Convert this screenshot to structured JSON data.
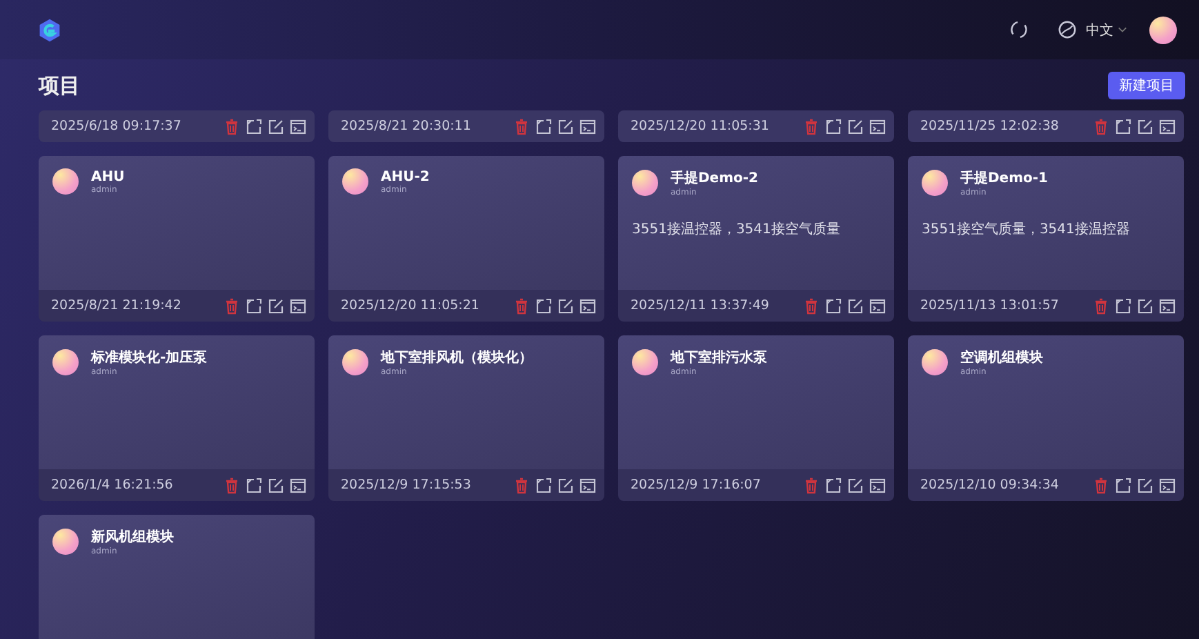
{
  "header": {
    "language": "中文"
  },
  "page": {
    "title": "项目",
    "new_button": "新建项目"
  },
  "scrolled_cards": [
    {
      "timestamp": "2025/6/18 09:17:37"
    },
    {
      "timestamp": "2025/8/21 20:30:11"
    },
    {
      "timestamp": "2025/12/20 11:05:31"
    },
    {
      "timestamp": "2025/11/25 12:02:38"
    }
  ],
  "cards": [
    {
      "name": "AHU",
      "owner": "admin",
      "timestamp": "2025/8/21 21:19:42"
    },
    {
      "name": "AHU-2",
      "owner": "admin",
      "timestamp": "2025/12/20 11:05:21"
    },
    {
      "name": "手提Demo-2",
      "owner": "admin",
      "description": "3551接温控器，3541接空气质量",
      "timestamp": "2025/12/11 13:37:49"
    },
    {
      "name": "手提Demo-1",
      "owner": "admin",
      "description": "3551接空气质量，3541接温控器",
      "timestamp": "2025/11/13 13:01:57"
    },
    {
      "name": "标准模块化-加压泵",
      "owner": "admin",
      "timestamp": "2026/1/4 16:21:56"
    },
    {
      "name": "地下室排风机（模块化）",
      "owner": "admin",
      "timestamp": "2025/12/9 17:15:53"
    },
    {
      "name": "地下室排污水泵",
      "owner": "admin",
      "timestamp": "2025/12/9 17:16:07"
    },
    {
      "name": "空调机组模块",
      "owner": "admin",
      "timestamp": "2025/12/10 09:34:34"
    },
    {
      "name": "新风机组模块",
      "owner": "admin"
    }
  ]
}
